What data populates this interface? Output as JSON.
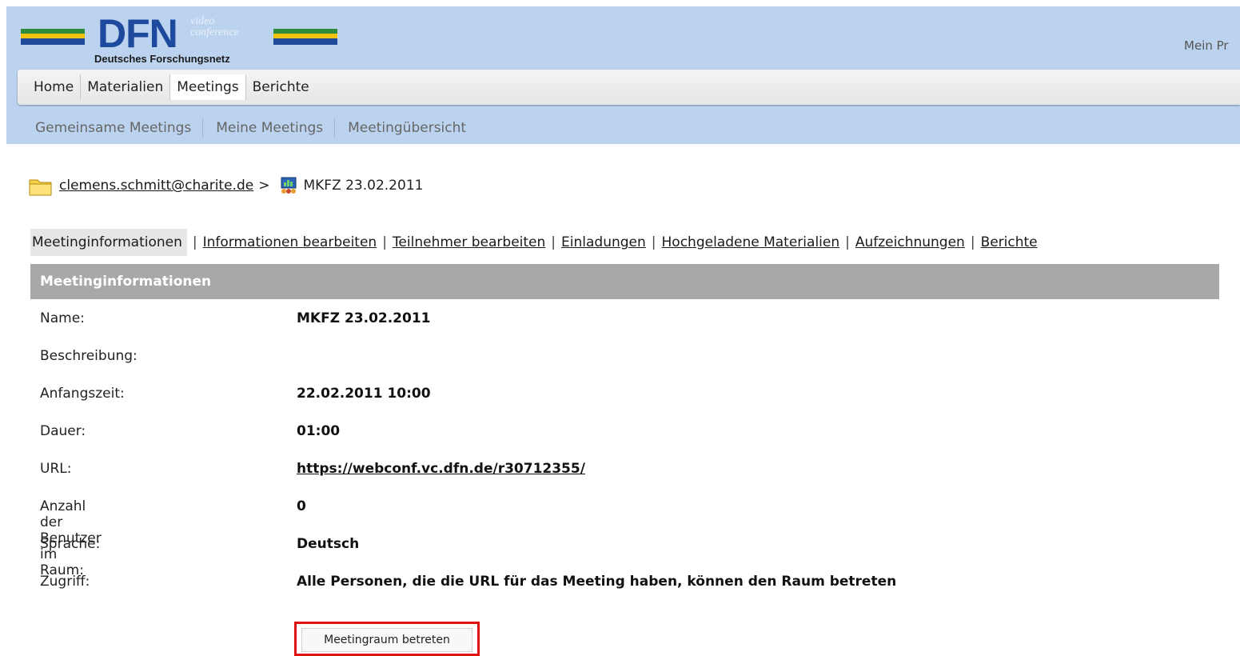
{
  "header": {
    "logo_text": "DFN",
    "logo_video": "video",
    "logo_conference": "conference",
    "logo_subtitle": "Deutsches Forschungsnetz",
    "profile_link": "Mein Pr"
  },
  "main_nav": {
    "tabs": [
      {
        "label": "Home"
      },
      {
        "label": "Materialien"
      },
      {
        "label": "Meetings",
        "active": true
      },
      {
        "label": "Berichte"
      }
    ]
  },
  "sub_nav": {
    "tabs": [
      {
        "label": "Gemeinsame Meetings"
      },
      {
        "label": "Meine Meetings"
      },
      {
        "label": "Meetingübersicht"
      }
    ]
  },
  "breadcrumb": {
    "folder": "clemens.schmitt@charite.de",
    "separator": ">",
    "meeting": "MKFZ 23.02.2011"
  },
  "tabs": {
    "items": [
      {
        "label": "Meetinginformationen",
        "active": true
      },
      {
        "label": "Informationen bearbeiten"
      },
      {
        "label": "Teilnehmer bearbeiten"
      },
      {
        "label": "Einladungen"
      },
      {
        "label": "Hochgeladene Materialien"
      },
      {
        "label": "Aufzeichnungen"
      },
      {
        "label": "Berichte"
      }
    ],
    "separator": "|"
  },
  "panel": {
    "title": "Meetinginformationen",
    "rows": [
      {
        "label": "Name:",
        "value": "MKFZ 23.02.2011"
      },
      {
        "label": "Beschreibung:",
        "value": ""
      },
      {
        "label": "Anfangszeit:",
        "value": "22.02.2011 10:00"
      },
      {
        "label": "Dauer:",
        "value": "01:00"
      },
      {
        "label": "URL:",
        "value": "https://webconf.vc.dfn.de/r30712355/"
      },
      {
        "label": "Anzahl der Benutzer im Raum:",
        "value": "0"
      },
      {
        "label": "Sprache:",
        "value": "Deutsch"
      },
      {
        "label": "Zugriff:",
        "value": "Alle Personen, die die URL für das Meeting haben, können den Raum betreten"
      }
    ],
    "join_button": "Meetingraum betreten"
  },
  "colors": {
    "header_bg": "#bcd3ef",
    "logo_blue": "#1e4a9e",
    "panel_header_bg": "#a8a8a8",
    "highlight_red": "#e01313"
  },
  "icons": {
    "folder": "folder-icon",
    "meeting": "meeting-room-icon"
  }
}
